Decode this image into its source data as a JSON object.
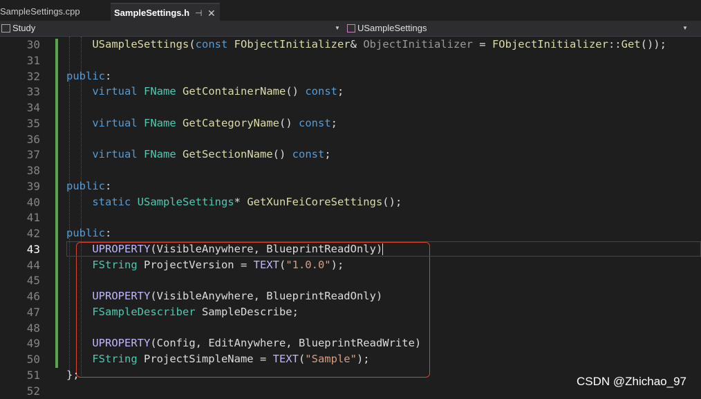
{
  "tabs": [
    {
      "label": "SampleSettings.cpp"
    },
    {
      "label": "SampleSettings.h",
      "pin": "⊣",
      "close": "✕"
    }
  ],
  "nav": {
    "project": "Study",
    "scope": "USampleSettings"
  },
  "colors": {
    "keyword": "#569cd6",
    "type": "#4ec9b0",
    "function": "#dcdcaa",
    "macro": "#beb7ff",
    "string": "#d69d85",
    "highlight_box": "#e0402e"
  },
  "current_line": 43,
  "code_lines": [
    {
      "num": "30",
      "tokens": [
        {
          "t": "    ",
          "c": "k-plain"
        },
        {
          "t": "USampleSettings",
          "c": "k-fn"
        },
        {
          "t": "(",
          "c": "k-plain"
        },
        {
          "t": "const",
          "c": "k-blue"
        },
        {
          "t": " ",
          "c": "k-plain"
        },
        {
          "t": "FObjectInitializer",
          "c": "k-fn"
        },
        {
          "t": "& ",
          "c": "k-plain"
        },
        {
          "t": "ObjectInitializer",
          "c": "k-param"
        },
        {
          "t": " = ",
          "c": "k-plain"
        },
        {
          "t": "FObjectInitializer",
          "c": "k-fn"
        },
        {
          "t": "::",
          "c": "k-plain"
        },
        {
          "t": "Get",
          "c": "k-fn"
        },
        {
          "t": "());",
          "c": "k-plain"
        }
      ]
    },
    {
      "num": "31",
      "tokens": []
    },
    {
      "num": "32",
      "tokens": [
        {
          "t": "public",
          "c": "k-blue"
        },
        {
          "t": ":",
          "c": "k-plain"
        }
      ]
    },
    {
      "num": "33",
      "tokens": [
        {
          "t": "    ",
          "c": "k-plain"
        },
        {
          "t": "virtual",
          "c": "k-blue"
        },
        {
          "t": " ",
          "c": "k-plain"
        },
        {
          "t": "FName",
          "c": "k-type"
        },
        {
          "t": " ",
          "c": "k-plain"
        },
        {
          "t": "GetContainerName",
          "c": "k-fn"
        },
        {
          "t": "() ",
          "c": "k-plain"
        },
        {
          "t": "const",
          "c": "k-blue"
        },
        {
          "t": ";",
          "c": "k-plain"
        }
      ]
    },
    {
      "num": "34",
      "tokens": []
    },
    {
      "num": "35",
      "tokens": [
        {
          "t": "    ",
          "c": "k-plain"
        },
        {
          "t": "virtual",
          "c": "k-blue"
        },
        {
          "t": " ",
          "c": "k-plain"
        },
        {
          "t": "FName",
          "c": "k-type"
        },
        {
          "t": " ",
          "c": "k-plain"
        },
        {
          "t": "GetCategoryName",
          "c": "k-fn"
        },
        {
          "t": "() ",
          "c": "k-plain"
        },
        {
          "t": "const",
          "c": "k-blue"
        },
        {
          "t": ";",
          "c": "k-plain"
        }
      ]
    },
    {
      "num": "36",
      "tokens": []
    },
    {
      "num": "37",
      "tokens": [
        {
          "t": "    ",
          "c": "k-plain"
        },
        {
          "t": "virtual",
          "c": "k-blue"
        },
        {
          "t": " ",
          "c": "k-plain"
        },
        {
          "t": "FName",
          "c": "k-type"
        },
        {
          "t": " ",
          "c": "k-plain"
        },
        {
          "t": "GetSectionName",
          "c": "k-fn"
        },
        {
          "t": "() ",
          "c": "k-plain"
        },
        {
          "t": "const",
          "c": "k-blue"
        },
        {
          "t": ";",
          "c": "k-plain"
        }
      ]
    },
    {
      "num": "38",
      "tokens": []
    },
    {
      "num": "39",
      "tokens": [
        {
          "t": "public",
          "c": "k-blue"
        },
        {
          "t": ":",
          "c": "k-plain"
        }
      ]
    },
    {
      "num": "40",
      "tokens": [
        {
          "t": "    ",
          "c": "k-plain"
        },
        {
          "t": "static",
          "c": "k-blue"
        },
        {
          "t": " ",
          "c": "k-plain"
        },
        {
          "t": "USampleSettings",
          "c": "k-type"
        },
        {
          "t": "* ",
          "c": "k-plain"
        },
        {
          "t": "GetXunFeiCoreSettings",
          "c": "k-fn"
        },
        {
          "t": "();",
          "c": "k-plain"
        }
      ]
    },
    {
      "num": "41",
      "tokens": []
    },
    {
      "num": "42",
      "tokens": [
        {
          "t": "public",
          "c": "k-blue"
        },
        {
          "t": ":",
          "c": "k-plain"
        }
      ]
    },
    {
      "num": "43",
      "tokens": [
        {
          "t": "    ",
          "c": "k-plain"
        },
        {
          "t": "UPROPERTY",
          "c": "k-macro"
        },
        {
          "t": "(VisibleAnywhere, BlueprintReadOnly)",
          "c": "k-plain"
        }
      ]
    },
    {
      "num": "44",
      "tokens": [
        {
          "t": "    ",
          "c": "k-plain"
        },
        {
          "t": "FString",
          "c": "k-type"
        },
        {
          "t": " ProjectVersion = ",
          "c": "k-plain"
        },
        {
          "t": "TEXT",
          "c": "k-macro"
        },
        {
          "t": "(",
          "c": "k-plain"
        },
        {
          "t": "\"1.0.0\"",
          "c": "k-str"
        },
        {
          "t": ");",
          "c": "k-plain"
        }
      ]
    },
    {
      "num": "45",
      "tokens": []
    },
    {
      "num": "46",
      "tokens": [
        {
          "t": "    ",
          "c": "k-plain"
        },
        {
          "t": "UPROPERTY",
          "c": "k-macro"
        },
        {
          "t": "(VisibleAnywhere, BlueprintReadOnly)",
          "c": "k-plain"
        }
      ]
    },
    {
      "num": "47",
      "tokens": [
        {
          "t": "    ",
          "c": "k-plain"
        },
        {
          "t": "FSampleDescriber",
          "c": "k-type"
        },
        {
          "t": " SampleDescribe;",
          "c": "k-plain"
        }
      ]
    },
    {
      "num": "48",
      "tokens": []
    },
    {
      "num": "49",
      "tokens": [
        {
          "t": "    ",
          "c": "k-plain"
        },
        {
          "t": "UPROPERTY",
          "c": "k-macro"
        },
        {
          "t": "(Config, EditAnywhere, BlueprintReadWrite)",
          "c": "k-plain"
        }
      ]
    },
    {
      "num": "50",
      "tokens": [
        {
          "t": "    ",
          "c": "k-plain"
        },
        {
          "t": "FString",
          "c": "k-type"
        },
        {
          "t": " ProjectSimpleName = ",
          "c": "k-plain"
        },
        {
          "t": "TEXT",
          "c": "k-macro"
        },
        {
          "t": "(",
          "c": "k-plain"
        },
        {
          "t": "\"Sample\"",
          "c": "k-str"
        },
        {
          "t": ");",
          "c": "k-plain"
        }
      ]
    },
    {
      "num": "51",
      "tokens": [
        {
          "t": "};",
          "c": "k-plain"
        }
      ]
    },
    {
      "num": "52",
      "tokens": []
    }
  ],
  "watermark": "CSDN @Zhichao_97"
}
